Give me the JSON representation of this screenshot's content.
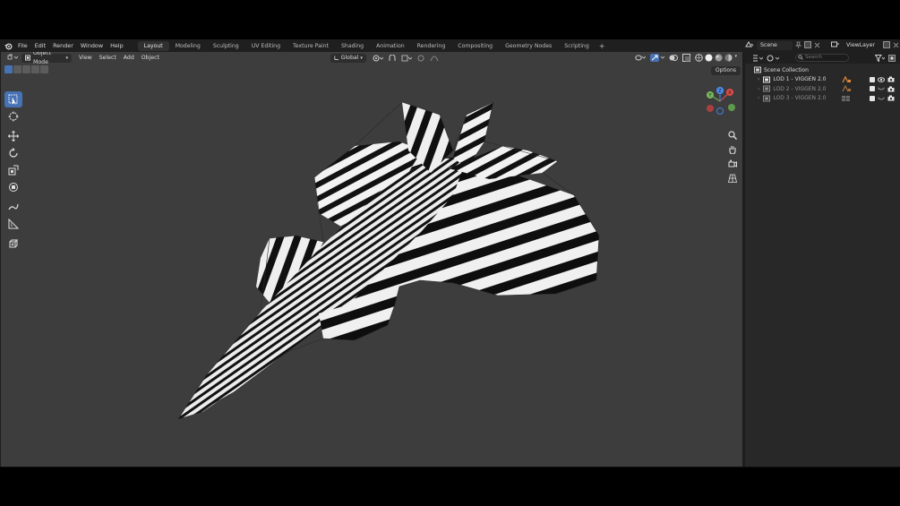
{
  "menu": [
    "File",
    "Edit",
    "Render",
    "Window",
    "Help"
  ],
  "workspaces": [
    {
      "label": "Layout",
      "active": true
    },
    {
      "label": "Modeling"
    },
    {
      "label": "Sculpting"
    },
    {
      "label": "UV Editing"
    },
    {
      "label": "Texture Paint"
    },
    {
      "label": "Shading"
    },
    {
      "label": "Animation"
    },
    {
      "label": "Rendering"
    },
    {
      "label": "Compositing"
    },
    {
      "label": "Geometry Nodes"
    },
    {
      "label": "Scripting"
    }
  ],
  "add_workspace": "+",
  "scene": {
    "name": "Scene",
    "view_layer": "ViewLayer"
  },
  "viewport": {
    "mode": "Object Mode",
    "menus": [
      "View",
      "Select",
      "Add",
      "Object"
    ],
    "orientation": "Global",
    "options": "Options",
    "gizmo_axes": {
      "z": "Z",
      "x": "X",
      "y": "Y"
    }
  },
  "outliner": {
    "search_placeholder": "Search",
    "root": "Scene Collection",
    "items": [
      {
        "label": "LOD 1 - VIGGEN 2.0",
        "visible": true
      },
      {
        "label": "LOD 2 - VIGGEN 2.0",
        "visible": false
      },
      {
        "label": "LOD 3 - VIGGEN 2.0",
        "visible": false
      }
    ]
  },
  "colors": {
    "accent": "#4772b3",
    "viewport_bg": "#3d3d3d",
    "panel_bg": "#282828"
  }
}
